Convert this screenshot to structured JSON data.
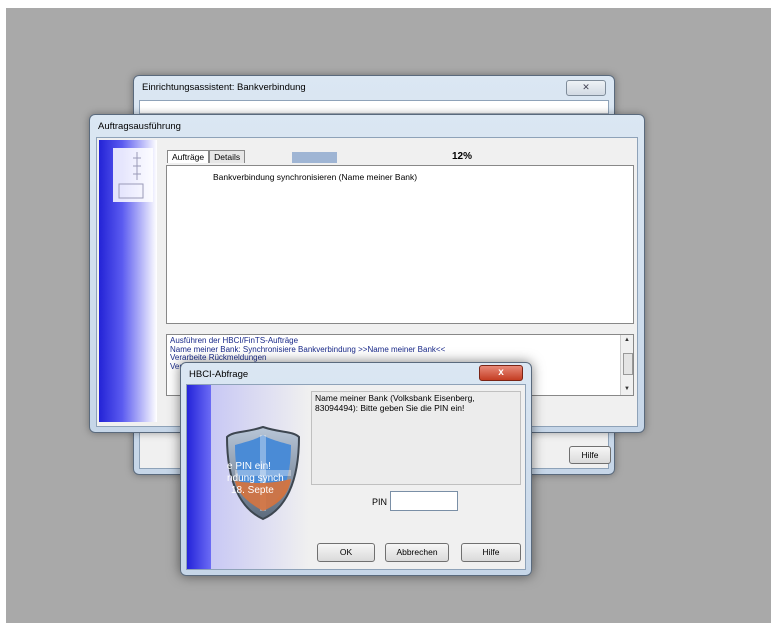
{
  "wizard": {
    "title": "Einrichtungsassistent: Bankverbindung",
    "close_label": "✕",
    "help_button": "Hilfe"
  },
  "tasks": {
    "title": "Auftragsausführung",
    "tabs": [
      "Aufträge",
      "Details"
    ],
    "progress_percent": "12%",
    "progress_fraction": 0.12,
    "job": "Bankverbindung synchronisieren (Name meiner Bank)",
    "log": [
      "Ausführen der HBCI/FinTS-Aufträge",
      "Name meiner Bank: Synchronisiere Bankverbindung >>Name meiner Bank<<",
      "Verarbeite Rückmeldungen",
      "Vera"
    ]
  },
  "hbci": {
    "title": "HBCI-Abfrage",
    "close_label": "x",
    "message": "Name meiner Bank (Volksbank Eisenberg, 83094494): Bitte geben Sie die PIN ein!",
    "pin_label": "PIN",
    "pin_value": "",
    "ok": "OK",
    "cancel": "Abbrechen",
    "help": "Hilfe",
    "shield_lines": [
      "e PIN ein!",
      "ndung synch",
      "18. Septe"
    ]
  },
  "colors": {
    "desktop": "#a9a9a9",
    "sidebar_blue": "#2323d6",
    "close_red": "#c43d23"
  }
}
